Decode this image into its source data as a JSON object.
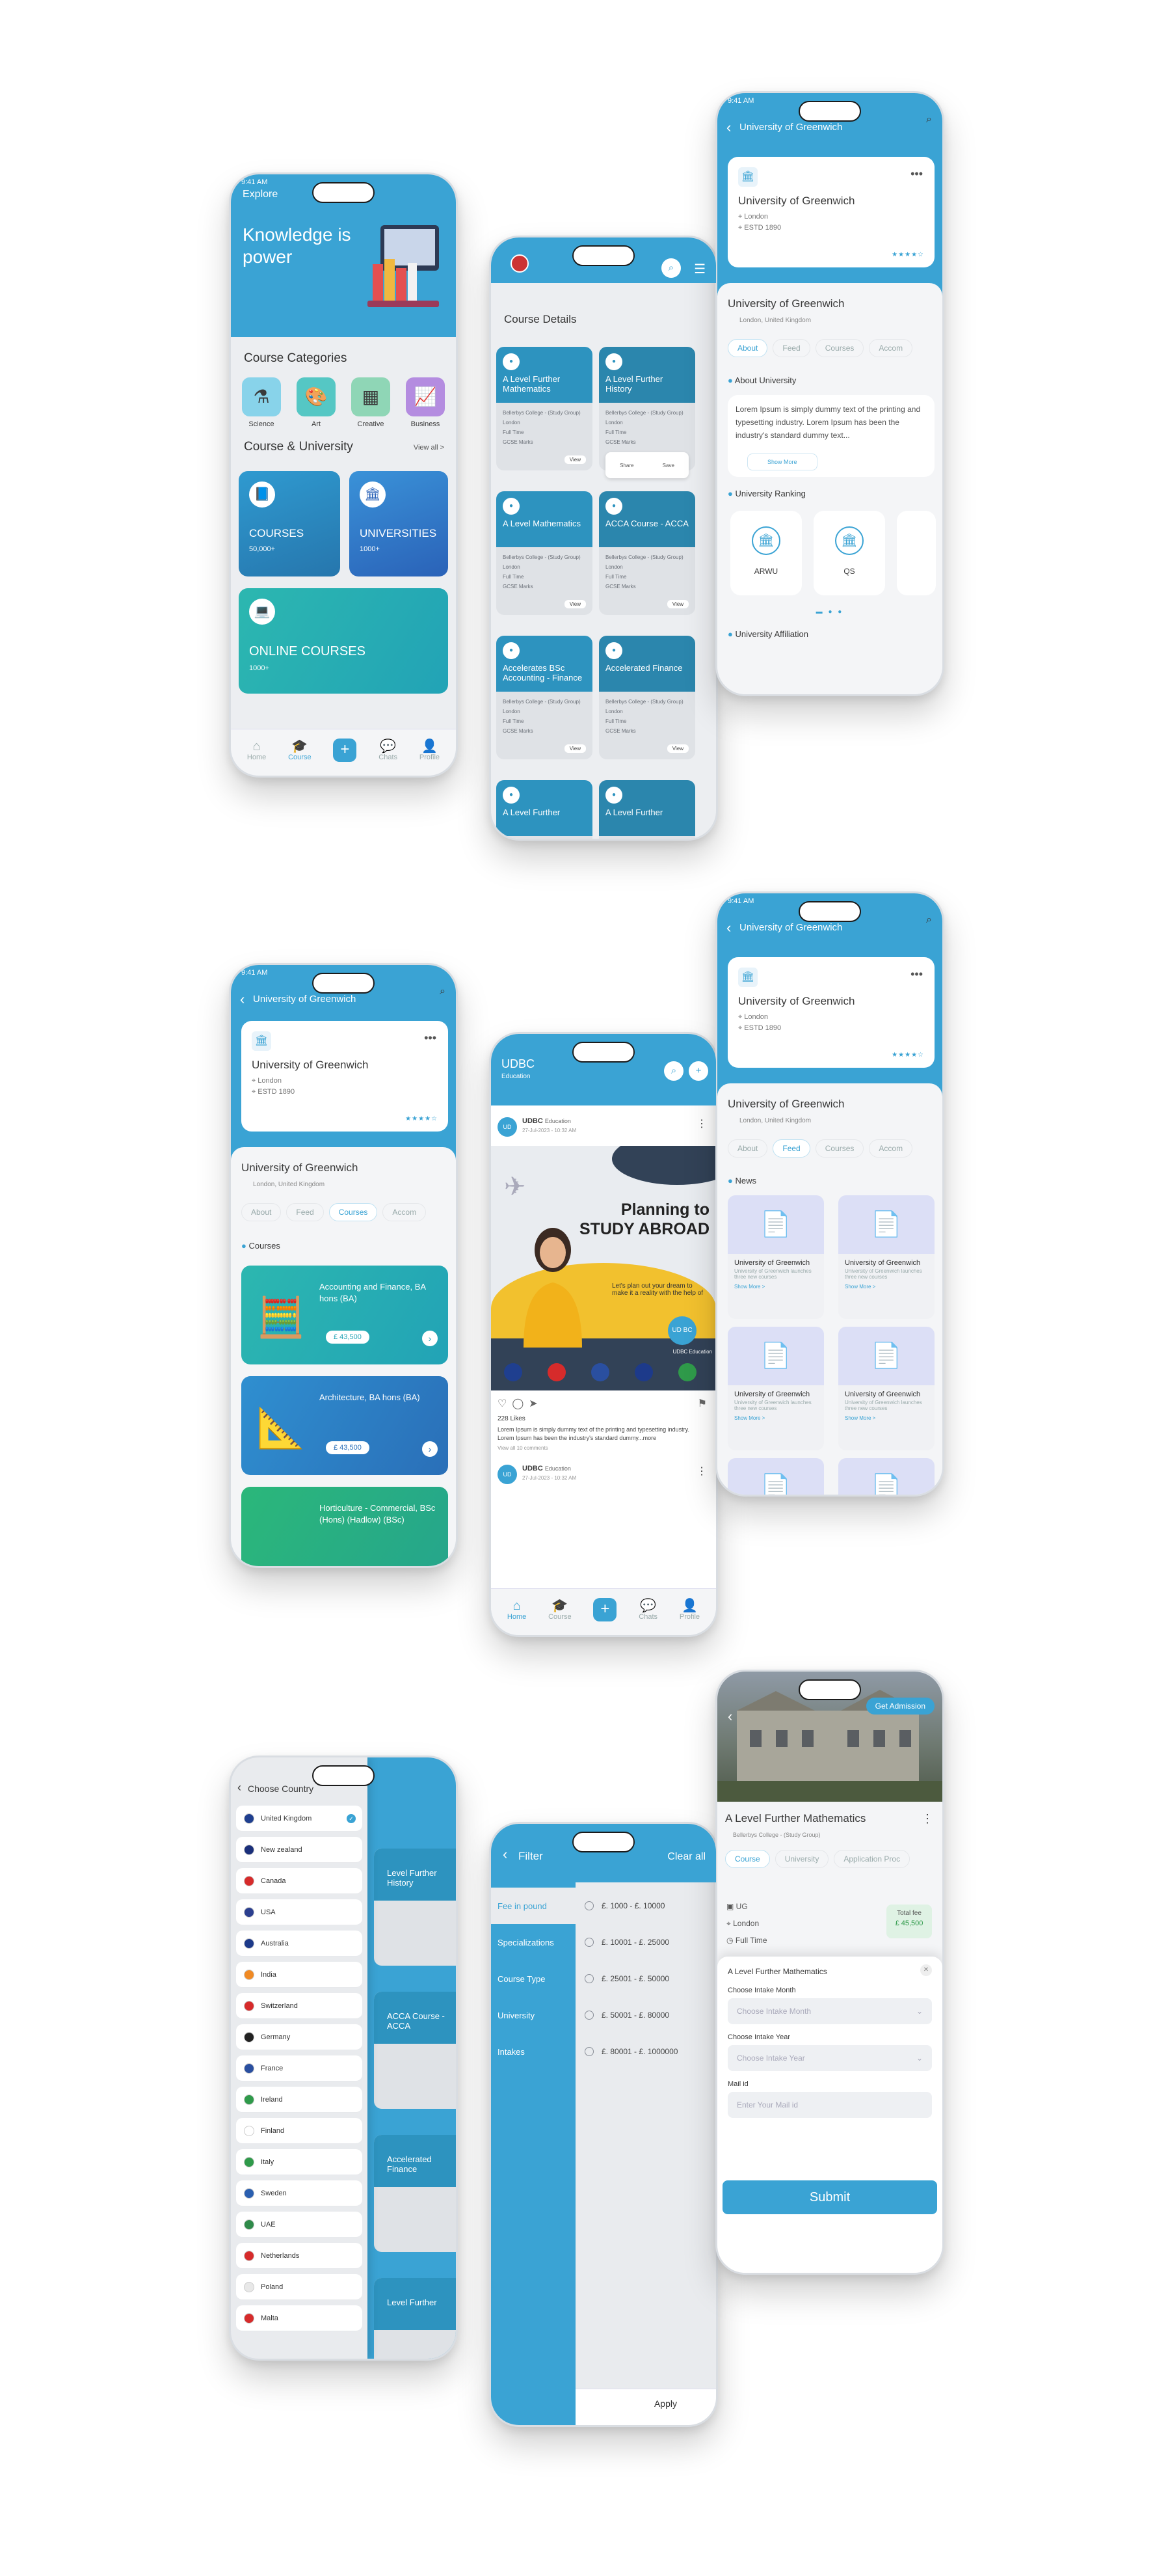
{
  "explore": {
    "status": "9:41 AM",
    "header": "Explore",
    "hero": "Knowledge is power",
    "categories_title": "Course Categories",
    "categories": [
      {
        "label": "Science",
        "icon": "flask-icon"
      },
      {
        "label": "Art",
        "icon": "palette-icon"
      },
      {
        "label": "Creative",
        "icon": "creative-icon"
      },
      {
        "label": "Business",
        "icon": "chart-icon"
      }
    ],
    "cu_title": "Course & University",
    "view_all": "View all >",
    "courses_label": "COURSES",
    "courses_count": "50,000+",
    "univ_label": "UNIVERSITIES",
    "univ_count": "1000+",
    "online_label": "ONLINE COURSES",
    "online_count": "1000+",
    "tabs": [
      "Home",
      "Course",
      "",
      "Chats",
      "Profile"
    ]
  },
  "details": {
    "section": "Course Details",
    "tiles": [
      {
        "title": "A Level Further Mathematics"
      },
      {
        "title": "A Level Further History"
      },
      {
        "title": "A Level Mathematics"
      },
      {
        "title": "ACCA Course - ACCA"
      },
      {
        "title": "Accelerates BSc Accounting - Finance"
      },
      {
        "title": "Accelerated Finance"
      },
      {
        "title": "A Level Further"
      },
      {
        "title": "A Level Further"
      }
    ],
    "meta1": "Bellerbys College - (Study Group)",
    "meta2": "London",
    "meta3": "Full Time",
    "meta4": "GCSE Marks",
    "view": "View",
    "share": "Share",
    "save": "Save"
  },
  "univ_about": {
    "header": "University of Greenwich",
    "status": "9:41 AM",
    "name": "University of Greenwich",
    "city": "London",
    "estd": "ESTD 1890",
    "name2": "University of Greenwich",
    "country": "London, United Kingdom",
    "tabs": [
      "About",
      "Feed",
      "Courses",
      "Accom"
    ],
    "about_title": "About University",
    "about_text": "Lorem Ipsum is simply dummy text of the printing and typesetting industry. Lorem Ipsum has been the industry's standard dummy text...",
    "show_more": "Show More",
    "ranking_title": "University Ranking",
    "rank1": "ARWU",
    "rank2": "QS",
    "affiliation": "University Affiliation"
  },
  "univ_courses": {
    "header": "University of Greenwich",
    "status": "9:41 AM",
    "name": "University of Greenwich",
    "city": "London",
    "estd": "ESTD 1890",
    "name2": "University of Greenwich",
    "country": "London, United Kingdom",
    "tabs": [
      "About",
      "Feed",
      "Courses",
      "Accom"
    ],
    "courses_title": "Courses",
    "course1": "Accounting and Finance, BA hons (BA)",
    "price1": "£ 43,500",
    "course2": "Architecture, BA hons (BA)",
    "price2": "£ 43,500",
    "course3": "Horticulture - Commercial, BSc (Hons) (Hadlow) (BSc)"
  },
  "feed": {
    "brand": "UDBC",
    "brand_sub": "Education",
    "post_name": "UDBC",
    "post_sub": "Education",
    "post_time": "27-Jul-2023 - 10:32 AM",
    "banner_l1": "Planning to",
    "banner_l2": "STUDY ABROAD",
    "banner_sub": "Let's plan out your dream to make it a reality with the help of",
    "badge": "UD BC",
    "badge_sub": "UDBC Education",
    "likes": "228 Likes",
    "caption": "Lorem Ipsum is simply dummy text of the printing and typesetting industry. Lorem Ipsum has been the industry's standard dummy...more",
    "comments": "View all 10 comments",
    "post2_name": "UDBC",
    "post2_sub": "Education",
    "post2_time": "27-Jul-2023 - 10:32 AM",
    "tabs": [
      "Home",
      "Course",
      "",
      "Chats",
      "Profile"
    ]
  },
  "univ_feed": {
    "header": "University of Greenwich",
    "status": "9:41 AM",
    "name": "University of Greenwich",
    "city": "London",
    "estd": "ESTD 1890",
    "name2": "University of Greenwich",
    "country": "London, United Kingdom",
    "tabs": [
      "About",
      "Feed",
      "Courses",
      "Accom"
    ],
    "news_title": "News",
    "news_item": "University of Greenwich",
    "news_desc": "University of Greenwich launches three new courses",
    "show_more": "Show More >"
  },
  "country": {
    "title": "Choose Country",
    "countries": [
      "United Kingdom",
      "New zealand",
      "Canada",
      "USA",
      "Australia",
      "India",
      "Switzerland",
      "Germany",
      "France",
      "Ireland",
      "Finland",
      "Italy",
      "Sweden",
      "UAE",
      "Netherlands",
      "Poland",
      "Malta"
    ],
    "flag_colors": [
      "#1f3f8f",
      "#1a2f7a",
      "#d62b2b",
      "#2b3f8f",
      "#1d3a8a",
      "#f08a24",
      "#d62b2b",
      "#222222",
      "#2a4fa0",
      "#2f9a4a",
      "#ffffff",
      "#2f9a4a",
      "#2a5fb0",
      "#2f8a4a",
      "#d62b2b",
      "#e8e8e8",
      "#d62b2b"
    ],
    "bg_tiles": [
      "Level Further History",
      "ACCA Course - ACCA",
      "Accelerated Finance",
      "Level Further"
    ]
  },
  "filter": {
    "title": "Filter",
    "clear": "Clear all",
    "cats": [
      "Fee in pound",
      "Specializations",
      "Course Type",
      "University",
      "Intakes"
    ],
    "options": [
      "£. 1000 - £. 10000",
      "£. 10001 - £. 25000",
      "£. 25001 - £. 50000",
      "£. 50001 - £. 80000",
      "£. 80001 - £. 1000000"
    ],
    "apply": "Apply"
  },
  "admission": {
    "get": "Get Admission",
    "title": "A Level Further Mathematics",
    "sub": "Bellerbys College - (Study Group)",
    "tabs": [
      "Course",
      "University",
      "Application Proc"
    ],
    "ug": "UG",
    "city": "London",
    "time": "Full Time",
    "fee_label": "Total fee",
    "fee": "£ 45,500",
    "modal_title": "A Level Further Mathematics",
    "month_label": "Choose Intake Month",
    "month_ph": "Choose Intake Month",
    "year_label": "Choose Intake Year",
    "year_ph": "Choose Intake Year",
    "mail_label": "Mail id",
    "mail_ph": "Enter Your Mail id",
    "submit": "Submit"
  }
}
